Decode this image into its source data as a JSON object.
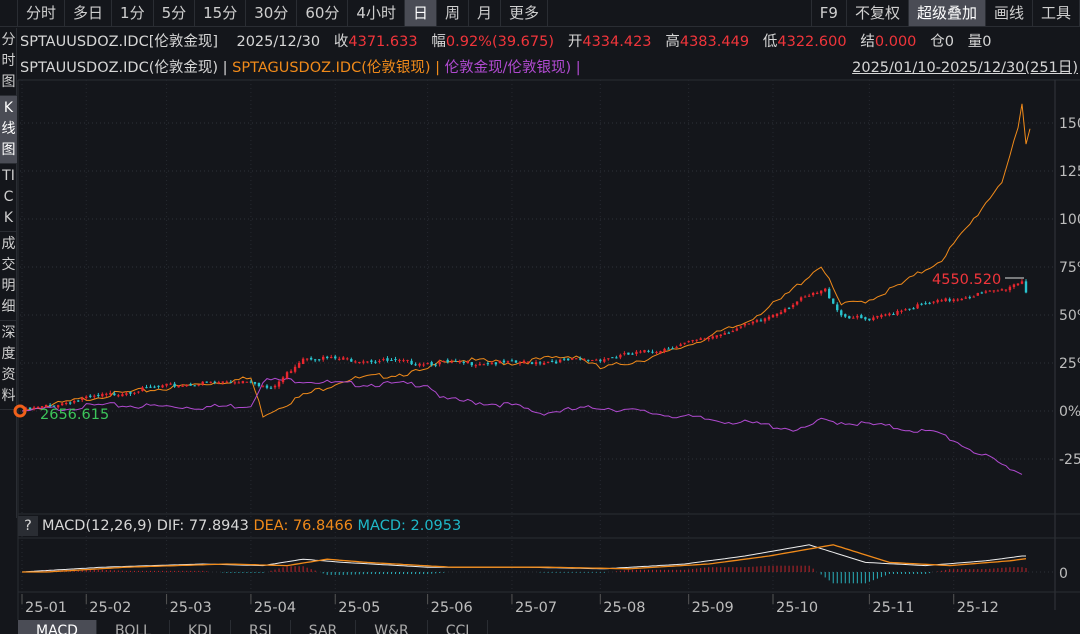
{
  "toolbar": {
    "periods": [
      "分时",
      "多日",
      "1分",
      "5分",
      "15分",
      "30分",
      "60分",
      "4小时",
      "日",
      "周",
      "月",
      "更多"
    ],
    "active": "日",
    "right": [
      "F9",
      "不复权",
      "超级叠加",
      "画线",
      "工具"
    ],
    "right_active": "超级叠加"
  },
  "side_tabs": [
    "分时图",
    "K线图",
    "TICK",
    "成交明细",
    "深度资料"
  ],
  "quote": {
    "symbol": "SPTAUUSDOZ.IDC[伦敦金现]",
    "date": "2025/12/30",
    "close_label": "收",
    "close": "4371.633",
    "change_label": "幅",
    "change": "0.92%(39.675)",
    "open_label": "开",
    "open": "4334.423",
    "high_label": "高",
    "high": "4383.449",
    "low_label": "低",
    "low": "4322.600",
    "settle_label": "结",
    "settle": "0.000",
    "oi_label": "仓",
    "oi": "0",
    "vol_label": "量",
    "vol": "0"
  },
  "overlay": {
    "s1": "SPTAUUSDOZ.IDC(伦敦金现) |",
    "s2": "SPTAGUSDOZ.IDC(伦敦银现) |",
    "s3": "伦敦金现/伦敦银现) |",
    "range": "2025/01/10-2025/12/30(251日)"
  },
  "markers": {
    "start": "2656.615",
    "high": "4550.520"
  },
  "macd": {
    "q": "?",
    "title": "MACD(12,26,9)",
    "dif": "DIF: 77.8943",
    "dea": "DEA: 76.8466",
    "macd": "MACD: 2.0953",
    "zero": "0"
  },
  "bottom_tabs": [
    "MACD",
    "BOLL",
    "KDJ",
    "RSI",
    "SAR",
    "W&R",
    "CCI"
  ],
  "colors": {
    "up": "#e8262e",
    "down": "#29c4cf",
    "silver": "#f08a1a",
    "ratio": "#b04ad0"
  },
  "chart_data": {
    "type": "line",
    "x_unit": "trading day index (0-250)",
    "yaxis_ticks": [
      "150%",
      "125%",
      "100%",
      "75%",
      "50%",
      "25%",
      "0%",
      "-25%"
    ],
    "ylim": [
      -35,
      165
    ],
    "xticks": [
      {
        "label": "25-01",
        "day": 0
      },
      {
        "label": "25-02",
        "day": 16
      },
      {
        "label": "25-03",
        "day": 36
      },
      {
        "label": "25-04",
        "day": 57
      },
      {
        "label": "25-05",
        "day": 78
      },
      {
        "label": "25-06",
        "day": 101
      },
      {
        "label": "25-07",
        "day": 122
      },
      {
        "label": "25-08",
        "day": 144
      },
      {
        "label": "25-09",
        "day": 166
      },
      {
        "label": "25-10",
        "day": 187
      },
      {
        "label": "25-11",
        "day": 211
      },
      {
        "label": "25-12",
        "day": 232
      }
    ],
    "series": [
      {
        "name": "伦敦金现",
        "style": "candle",
        "points": [
          [
            0,
            0
          ],
          [
            20,
            8
          ],
          [
            36,
            13
          ],
          [
            57,
            16
          ],
          [
            62,
            11
          ],
          [
            70,
            28
          ],
          [
            80,
            27
          ],
          [
            101,
            25
          ],
          [
            122,
            25
          ],
          [
            144,
            27
          ],
          [
            159,
            32
          ],
          [
            169,
            37
          ],
          [
            184,
            47
          ],
          [
            194,
            58
          ],
          [
            200,
            63
          ],
          [
            204,
            50
          ],
          [
            211,
            47
          ],
          [
            219,
            53
          ],
          [
            231,
            58
          ],
          [
            244,
            63
          ],
          [
            249,
            68
          ],
          [
            250,
            62
          ]
        ]
      },
      {
        "name": "伦敦银现",
        "style": "line",
        "points": [
          [
            0,
            0
          ],
          [
            20,
            8
          ],
          [
            36,
            12
          ],
          [
            57,
            17
          ],
          [
            60,
            -2
          ],
          [
            70,
            8
          ],
          [
            80,
            16
          ],
          [
            101,
            21
          ],
          [
            105,
            27
          ],
          [
            122,
            25
          ],
          [
            138,
            29
          ],
          [
            144,
            22
          ],
          [
            159,
            29
          ],
          [
            169,
            37
          ],
          [
            179,
            45
          ],
          [
            189,
            58
          ],
          [
            199,
            76
          ],
          [
            204,
            55
          ],
          [
            211,
            58
          ],
          [
            219,
            66
          ],
          [
            229,
            79
          ],
          [
            236,
            97
          ],
          [
            244,
            120
          ],
          [
            248,
            146
          ],
          [
            249,
            160
          ],
          [
            250,
            139
          ],
          [
            251,
            147
          ]
        ]
      },
      {
        "name": "伦敦金现/伦敦银现",
        "style": "line",
        "points": [
          [
            0,
            0
          ],
          [
            20,
            3
          ],
          [
            45,
            2
          ],
          [
            57,
            3
          ],
          [
            60,
            16
          ],
          [
            70,
            16
          ],
          [
            80,
            14
          ],
          [
            101,
            14
          ],
          [
            105,
            6
          ],
          [
            122,
            3
          ],
          [
            129,
            -1
          ],
          [
            144,
            2
          ],
          [
            169,
            -4
          ],
          [
            184,
            -7
          ],
          [
            194,
            -10
          ],
          [
            199,
            -5
          ],
          [
            211,
            -7
          ],
          [
            219,
            -9
          ],
          [
            229,
            -12
          ],
          [
            239,
            -23
          ],
          [
            249,
            -33
          ]
        ]
      }
    ]
  }
}
